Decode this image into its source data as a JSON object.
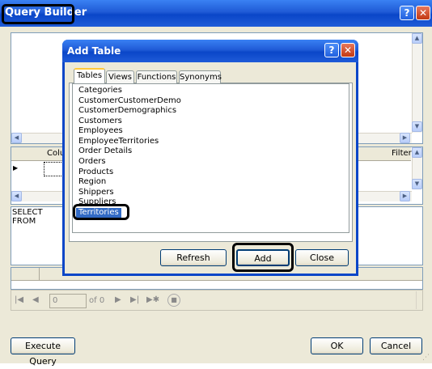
{
  "query_builder": {
    "title": "Query Builder",
    "grid": {
      "columns": [
        "Colu",
        "Filter"
      ],
      "row_marker": "▶"
    },
    "sql_lines": [
      "SELECT",
      "FROM"
    ],
    "navigator": {
      "page_value": "0",
      "of_label": "of 0"
    },
    "buttons": {
      "execute_query": "Execute Query",
      "ok": "OK",
      "cancel": "Cancel"
    }
  },
  "add_table": {
    "title": "Add Table",
    "tabs": [
      "Tables",
      "Views",
      "Functions",
      "Synonyms"
    ],
    "active_tab": "Tables",
    "tables": [
      "Categories",
      "CustomerCustomerDemo",
      "CustomerDemographics",
      "Customers",
      "Employees",
      "EmployeeTerritories",
      "Order Details",
      "Orders",
      "Products",
      "Region",
      "Shippers",
      "Suppliers",
      "Territories"
    ],
    "selected_table": "Territories",
    "buttons": {
      "refresh": "Refresh",
      "add": "Add",
      "close": "Close"
    }
  },
  "colors": {
    "title_bar": "#0a46c8",
    "window_bg": "#ece9d8",
    "selection": "#316ac5",
    "close_button": "#c23912"
  },
  "icons": [
    "help-icon",
    "close-icon",
    "scroll-up-icon",
    "scroll-down-icon",
    "scroll-left-icon",
    "scroll-right-icon",
    "move-first-icon",
    "move-previous-icon",
    "move-next-icon",
    "move-last-icon",
    "add-new-icon",
    "stop-icon",
    "resize-grip-icon"
  ]
}
